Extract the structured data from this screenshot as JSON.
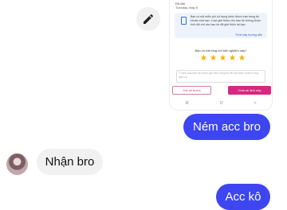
{
  "screenshot": {
    "header_lines": [
      "Đã đặt",
      "Tuesday, May 5"
    ],
    "notice": {
      "text": "Bạn có mã miễn phí sử dụng kênh được trao trong tài khoản của bạn. Lượt giới thiệu cho bạn bè không được tính đối với các bạn bè đã giới thiệu lại bạn.",
      "link": "Trình bày hướng dẫn"
    },
    "rating_question": "Bạn có hài lòng với trải nghiệm này?",
    "stars": 5,
    "comment_placeholder": "Ý kiến của bạn sẽ được gửi đến Shopee để cải thiện chất lượng dịch vụ",
    "skip_button": "Trở về trước",
    "submit_button": "Chia sẻ ảnh này",
    "nav_icons": [
      "III",
      "O",
      "<"
    ]
  },
  "messages": [
    {
      "direction": "outgoing",
      "text": "Ném acc bro"
    },
    {
      "direction": "incoming",
      "text": "Nhận bro"
    },
    {
      "direction": "outgoing",
      "text": "Acc kô"
    }
  ],
  "colors": {
    "outgoing_bubble": "#3d46f1",
    "incoming_bubble": "#f1f1f1",
    "accent_pink": "#d6287e"
  },
  "icons": {
    "edit": "pencil-icon"
  }
}
